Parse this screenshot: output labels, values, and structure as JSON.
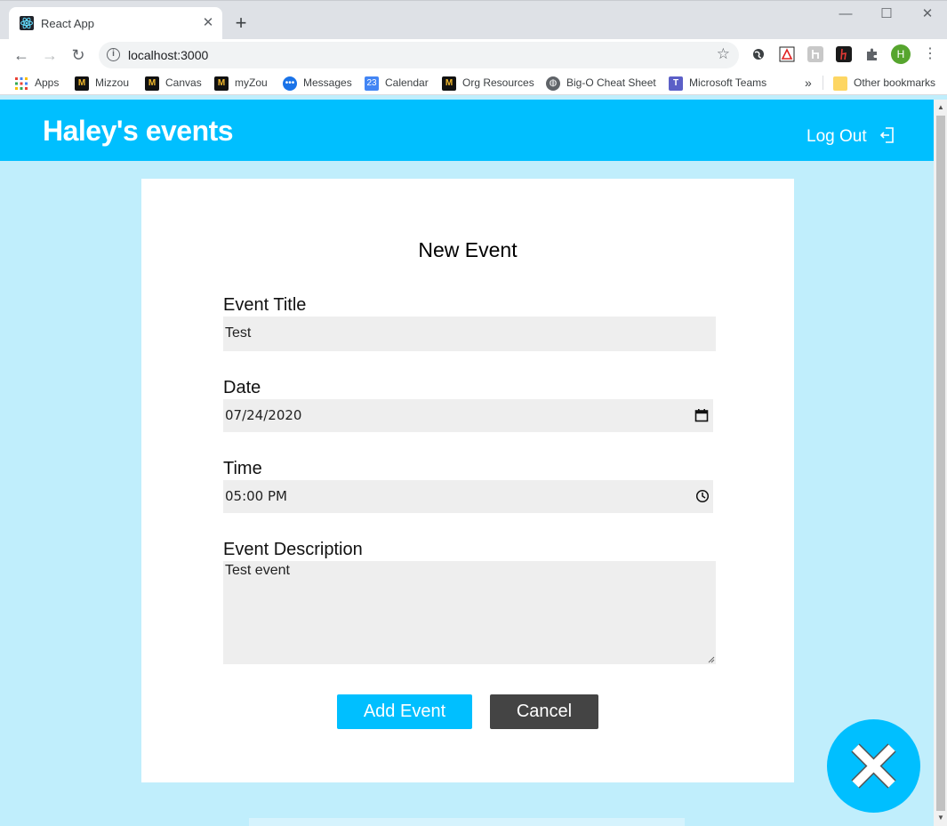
{
  "browser": {
    "tab_title": "React App",
    "tab_close": "✕",
    "new_tab": "+",
    "url": "localhost:3000",
    "info_glyph": "i",
    "star_glyph": "☆",
    "profile_initial": "H",
    "window_controls": {
      "minimize": "—",
      "maximize": "☐",
      "close": "✕"
    },
    "nav": {
      "back": "←",
      "forward": "→",
      "reload": "↻"
    },
    "extensions": [
      "globe-extension-icon",
      "pdf-extension-icon",
      "reader-extension-icon",
      "h-extension-icon",
      "puzzle-extension-icon"
    ],
    "bookmarks": [
      {
        "label": "Apps",
        "icon": "apps-grid-icon"
      },
      {
        "label": "Mizzou",
        "icon": "mizzou-icon"
      },
      {
        "label": "Canvas",
        "icon": "mizzou-icon"
      },
      {
        "label": "myZou",
        "icon": "mizzou-icon"
      },
      {
        "label": "Messages",
        "icon": "messages-icon"
      },
      {
        "label": "Calendar",
        "icon": "calendar-icon",
        "icon_text": "23"
      },
      {
        "label": "Org Resources",
        "icon": "mizzou-icon"
      },
      {
        "label": "Big-O Cheat Sheet",
        "icon": "globe-icon"
      },
      {
        "label": "Microsoft Teams",
        "icon": "teams-icon"
      }
    ],
    "bookmarks_overflow": "»",
    "other_bookmarks": "Other bookmarks"
  },
  "app": {
    "title": "Haley's events",
    "logout_label": "Log Out",
    "accent_color": "#00bfff",
    "background_color": "#c0eefc"
  },
  "form": {
    "heading": "New Event",
    "title_label": "Event Title",
    "title_value": "Test",
    "date_label": "Date",
    "date_value": "07/24/2020",
    "time_label": "Time",
    "time_value": "05:00 PM",
    "description_label": "Event Description",
    "description_value": "Test event",
    "add_button": "Add Event",
    "cancel_button": "Cancel"
  }
}
